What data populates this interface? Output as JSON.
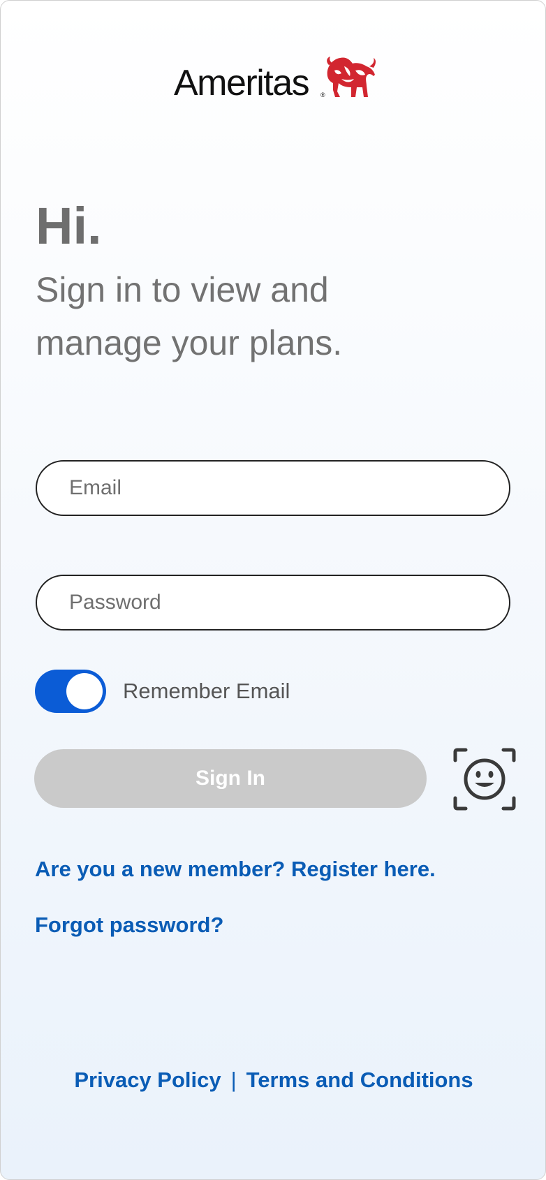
{
  "brand": {
    "name": "Ameritas",
    "registered_mark": "®",
    "logo_icon": "bison-icon",
    "logo_color": "#d22630"
  },
  "header": {
    "greeting": "Hi.",
    "subtitle": "Sign in to view and manage your plans."
  },
  "form": {
    "email_placeholder": "Email",
    "email_value": "",
    "password_placeholder": "Password",
    "password_value": "",
    "remember_email_label": "Remember Email",
    "remember_email_on": true,
    "sign_in_label": "Sign In",
    "sign_in_enabled": false,
    "face_id_icon": "face-id-icon"
  },
  "links": {
    "register": "Are you a new member? Register here.",
    "forgot_password": "Forgot password?"
  },
  "footer": {
    "privacy_policy": "Privacy Policy",
    "separator": "|",
    "terms": "Terms and Conditions"
  },
  "colors": {
    "accent": "#0b5cd6",
    "link": "#0a5cb5",
    "disabled_button": "#cacaca",
    "heading_text": "#6e6e6e"
  }
}
